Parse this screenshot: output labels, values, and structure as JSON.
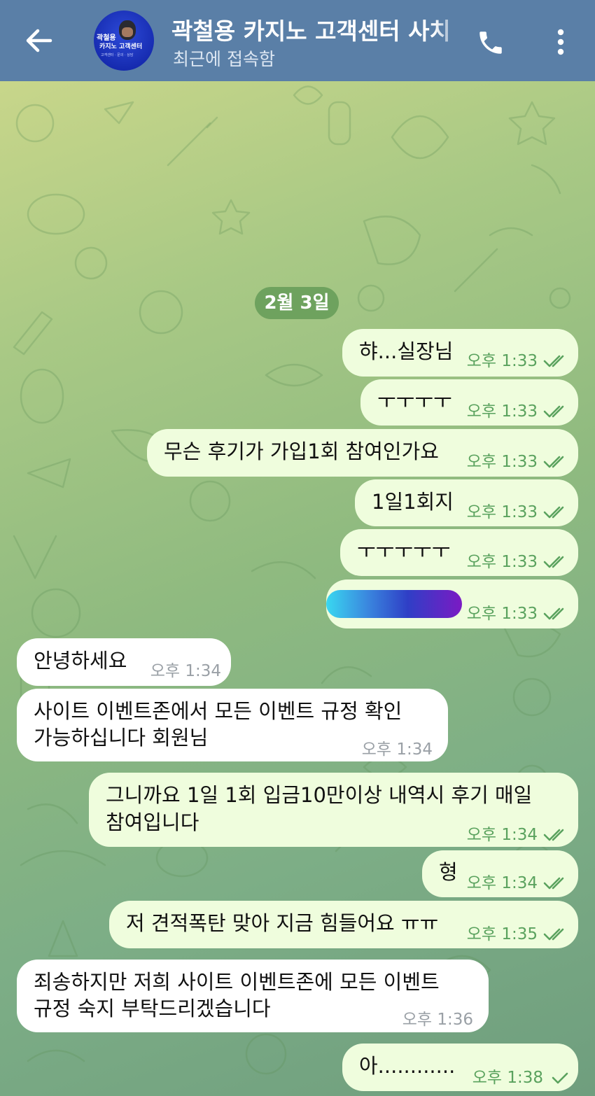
{
  "header": {
    "title": "곽철용 카지노 고객센터 사치",
    "status": "최근에 접속함",
    "avatar_line1": "곽철용",
    "avatar_line2": "카지노 고객센터",
    "avatar_line3": "고객센터 · 문의 · 상담",
    "colors": {
      "header_bg": "#5a7fa7",
      "outgoing_bubble": "#effddd",
      "incoming_bubble": "#ffffff",
      "date_pill": "#6ea25e"
    }
  },
  "chat": {
    "date_label": "2월 3일",
    "messages": [
      {
        "dir": "out",
        "lines": [
          "햐...실장님"
        ],
        "time": "오후 1:33",
        "read": true
      },
      {
        "dir": "out",
        "lines": [
          "ㅜㅜㅜㅜ"
        ],
        "time": "오후 1:33",
        "read": true
      },
      {
        "dir": "out",
        "lines": [
          "무슨 후기가 가입1회 참여인가요"
        ],
        "time": "오후 1:33",
        "read": true
      },
      {
        "dir": "out",
        "lines": [
          "1일1회지"
        ],
        "time": "오후 1:33",
        "read": true
      },
      {
        "dir": "out",
        "lines": [
          "ㅜㅜㅜㅜㅜ"
        ],
        "time": "오후 1:33",
        "read": true
      },
      {
        "dir": "out",
        "lines": [],
        "time": "오후 1:33",
        "read": true,
        "redacted": true
      },
      {
        "dir": "in",
        "lines": [
          "안녕하세요"
        ],
        "time": "오후 1:34"
      },
      {
        "dir": "in",
        "lines": [
          "사이트 이벤트존에서 모든 이벤트 규정 확인",
          "가능하십니다 회원님"
        ],
        "time": "오후 1:34"
      },
      {
        "dir": "out",
        "lines": [
          "그니까요 1일 1회 입금10만이상 내역시 후기 매일",
          "참여입니다"
        ],
        "time": "오후 1:34",
        "read": true
      },
      {
        "dir": "out",
        "lines": [
          "형"
        ],
        "time": "오후 1:34",
        "read": true
      },
      {
        "dir": "out",
        "lines": [
          "저 견적폭탄 맞아 지금 힘들어요 ㅠㅠ"
        ],
        "time": "오후 1:35",
        "read": true
      },
      {
        "dir": "in",
        "lines": [
          "죄송하지만 저희 사이트 이벤트존에 모든 이벤트",
          "규정 숙지 부탁드리겠습니다"
        ],
        "time": "오후 1:36"
      },
      {
        "dir": "out",
        "lines": [
          "아............"
        ],
        "time": "오후 1:38",
        "read": false
      }
    ]
  }
}
